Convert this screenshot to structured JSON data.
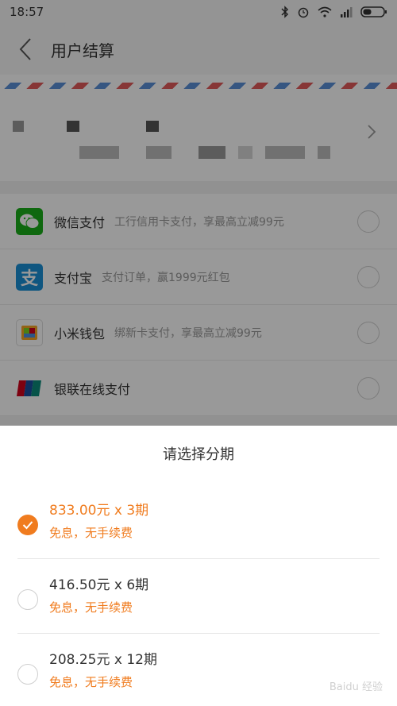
{
  "status_bar": {
    "time": "18:57"
  },
  "header": {
    "title": "用户结算"
  },
  "payment_methods": [
    {
      "name": "微信支付",
      "desc": "工行信用卡支付，享最高立减99元",
      "icon": "wechat-pay-icon",
      "color": "#1aad19"
    },
    {
      "name": "支付宝",
      "desc": "支付订单，赢1999元红包",
      "icon": "alipay-icon",
      "color": "#1a8fd6"
    },
    {
      "name": "小米钱包",
      "desc": "绑新卡支付，享最高立减99元",
      "icon": "mi-wallet-icon",
      "color": "#f5a623"
    },
    {
      "name": "银联在线支付",
      "desc": "",
      "icon": "unionpay-icon",
      "color": "#d0021b"
    }
  ],
  "sheet": {
    "title": "请选择分期",
    "plans": [
      {
        "amount": "833.00元 x 3期",
        "note": "免息，无手续费",
        "selected": true
      },
      {
        "amount": "416.50元 x 6期",
        "note": "免息，无手续费",
        "selected": false
      },
      {
        "amount": "208.25元 x 12期",
        "note": "免息，无手续费",
        "selected": false
      }
    ]
  },
  "colors": {
    "accent": "#f07c1f"
  },
  "watermark": "Baidu 经验"
}
